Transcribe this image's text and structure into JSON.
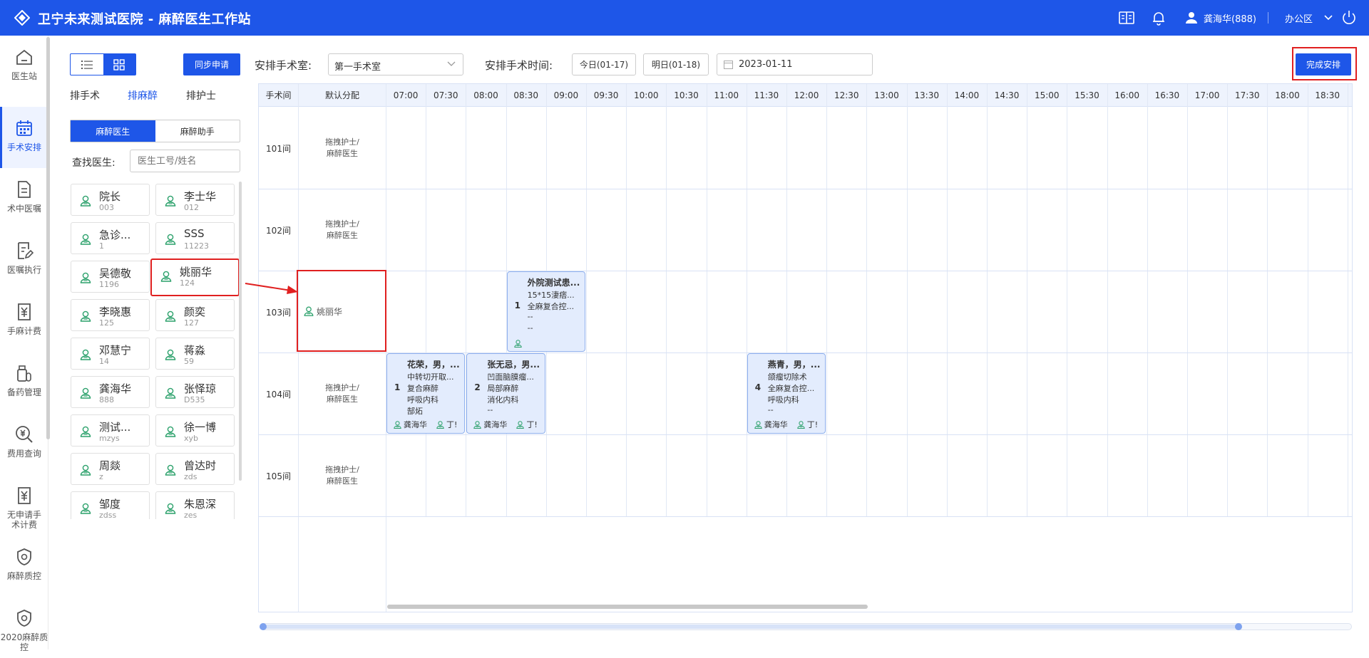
{
  "app": {
    "title": "卫宁未来测试医院 - 麻醉医生工作站",
    "user": "龚海华(888)",
    "office": "办公区"
  },
  "nav": [
    {
      "label": "医生站",
      "icon": "home-icon"
    },
    {
      "label": "手术安排",
      "icon": "calendar-icon",
      "active": true
    },
    {
      "label": "术中医嘱",
      "icon": "document-icon"
    },
    {
      "label": "医嘱执行",
      "icon": "edit-document-icon"
    },
    {
      "label": "手麻计费",
      "icon": "yuan-icon"
    },
    {
      "label": "备药管理",
      "icon": "medicine-icon"
    },
    {
      "label": "费用查询",
      "icon": "yuan-search-icon"
    },
    {
      "label": "无申请手术计费",
      "icon": "yuan-icon"
    },
    {
      "label": "麻醉质控",
      "icon": "shield-icon"
    },
    {
      "label": "2020麻醉质控",
      "icon": "shield-icon"
    }
  ],
  "panel": {
    "sync_button": "同步申请",
    "tabs": [
      "排手术",
      "排麻醉",
      "排护士"
    ],
    "active_tab": 1,
    "subtabs": [
      "麻醉医生",
      "麻醉助手"
    ],
    "find_label": "查找医生:",
    "find_placeholder": "医生工号/姓名",
    "doctors": [
      {
        "name": "院长",
        "code": "003"
      },
      {
        "name": "李士华",
        "code": "012"
      },
      {
        "name": "急诊...",
        "code": "1"
      },
      {
        "name": "SSS",
        "code": "11223"
      },
      {
        "name": "吴德敬",
        "code": "1196"
      },
      {
        "name": "姚丽华",
        "code": "124",
        "selected": true
      },
      {
        "name": "李晓惠",
        "code": "125"
      },
      {
        "name": "颜奕",
        "code": "127"
      },
      {
        "name": "邓慧宁",
        "code": "14"
      },
      {
        "name": "蒋淼",
        "code": "59"
      },
      {
        "name": "龚海华",
        "code": "888"
      },
      {
        "name": "张怿琼",
        "code": "D535"
      },
      {
        "name": "测试...",
        "code": "mzys"
      },
      {
        "name": "徐一博",
        "code": "xyb"
      },
      {
        "name": "周燚",
        "code": "z"
      },
      {
        "name": "曾达时",
        "code": "zds"
      },
      {
        "name": "邹度",
        "code": "zdss"
      },
      {
        "name": "朱恩深",
        "code": "zes"
      }
    ]
  },
  "header": {
    "room_label": "安排手术室:",
    "room_value": "第一手术室",
    "time_label": "安排手术时间:",
    "today": "今日(01-17)",
    "tomorrow": "明日(01-18)",
    "date": "2023-01-11",
    "finish_button": "完成安排"
  },
  "grid": {
    "col_room": "手术间",
    "col_default": "默认分配",
    "times": [
      "07:00",
      "07:30",
      "08:00",
      "08:30",
      "09:00",
      "09:30",
      "10:00",
      "10:30",
      "11:00",
      "11:30",
      "12:00",
      "12:30",
      "13:00",
      "13:30",
      "14:00",
      "14:30",
      "15:00",
      "15:30",
      "16:00",
      "16:30",
      "17:00",
      "17:30",
      "18:00",
      "18:30"
    ],
    "rooms": [
      {
        "name": "101间",
        "default": [
          "拖拽护士/",
          "麻醉医生"
        ]
      },
      {
        "name": "102间",
        "default": [
          "拖拽护士/",
          "麻醉医生"
        ]
      },
      {
        "name": "103间",
        "assigned": "姚丽华"
      },
      {
        "name": "104间",
        "default": [
          "拖拽护士/",
          "麻醉医生"
        ]
      },
      {
        "name": "105间",
        "default": [
          "拖拽护士/",
          "麻醉医生"
        ]
      }
    ],
    "cards": [
      {
        "room": 2,
        "start": 3,
        "title": "外院测试患...",
        "num": "1",
        "lines": [
          "15*15淒痞...",
          "全麻复合控...",
          "--",
          "--"
        ],
        "footer": []
      },
      {
        "room": 3,
        "start": 0,
        "title": "花荣，男，...",
        "num": "1",
        "lines": [
          "中转切开取...",
          "复合麻醉",
          "呼吸内科",
          "郜炻"
        ],
        "footer": [
          "龚海华",
          "丁!"
        ]
      },
      {
        "room": 3,
        "start": 2,
        "title": "张无忌，男...",
        "num": "2",
        "lines": [
          "凹面脑膜瘤...",
          "局部麻醉",
          "消化内科",
          "--"
        ],
        "footer": [
          "龚海华",
          "丁!"
        ]
      },
      {
        "room": 3,
        "start": 9,
        "title": "燕青，男，...",
        "num": "4",
        "lines": [
          "颌瘤切除术",
          "全麻复合控...",
          "呼吸内科",
          "--"
        ],
        "footer": [
          "龚海华",
          "丁!"
        ]
      }
    ]
  }
}
